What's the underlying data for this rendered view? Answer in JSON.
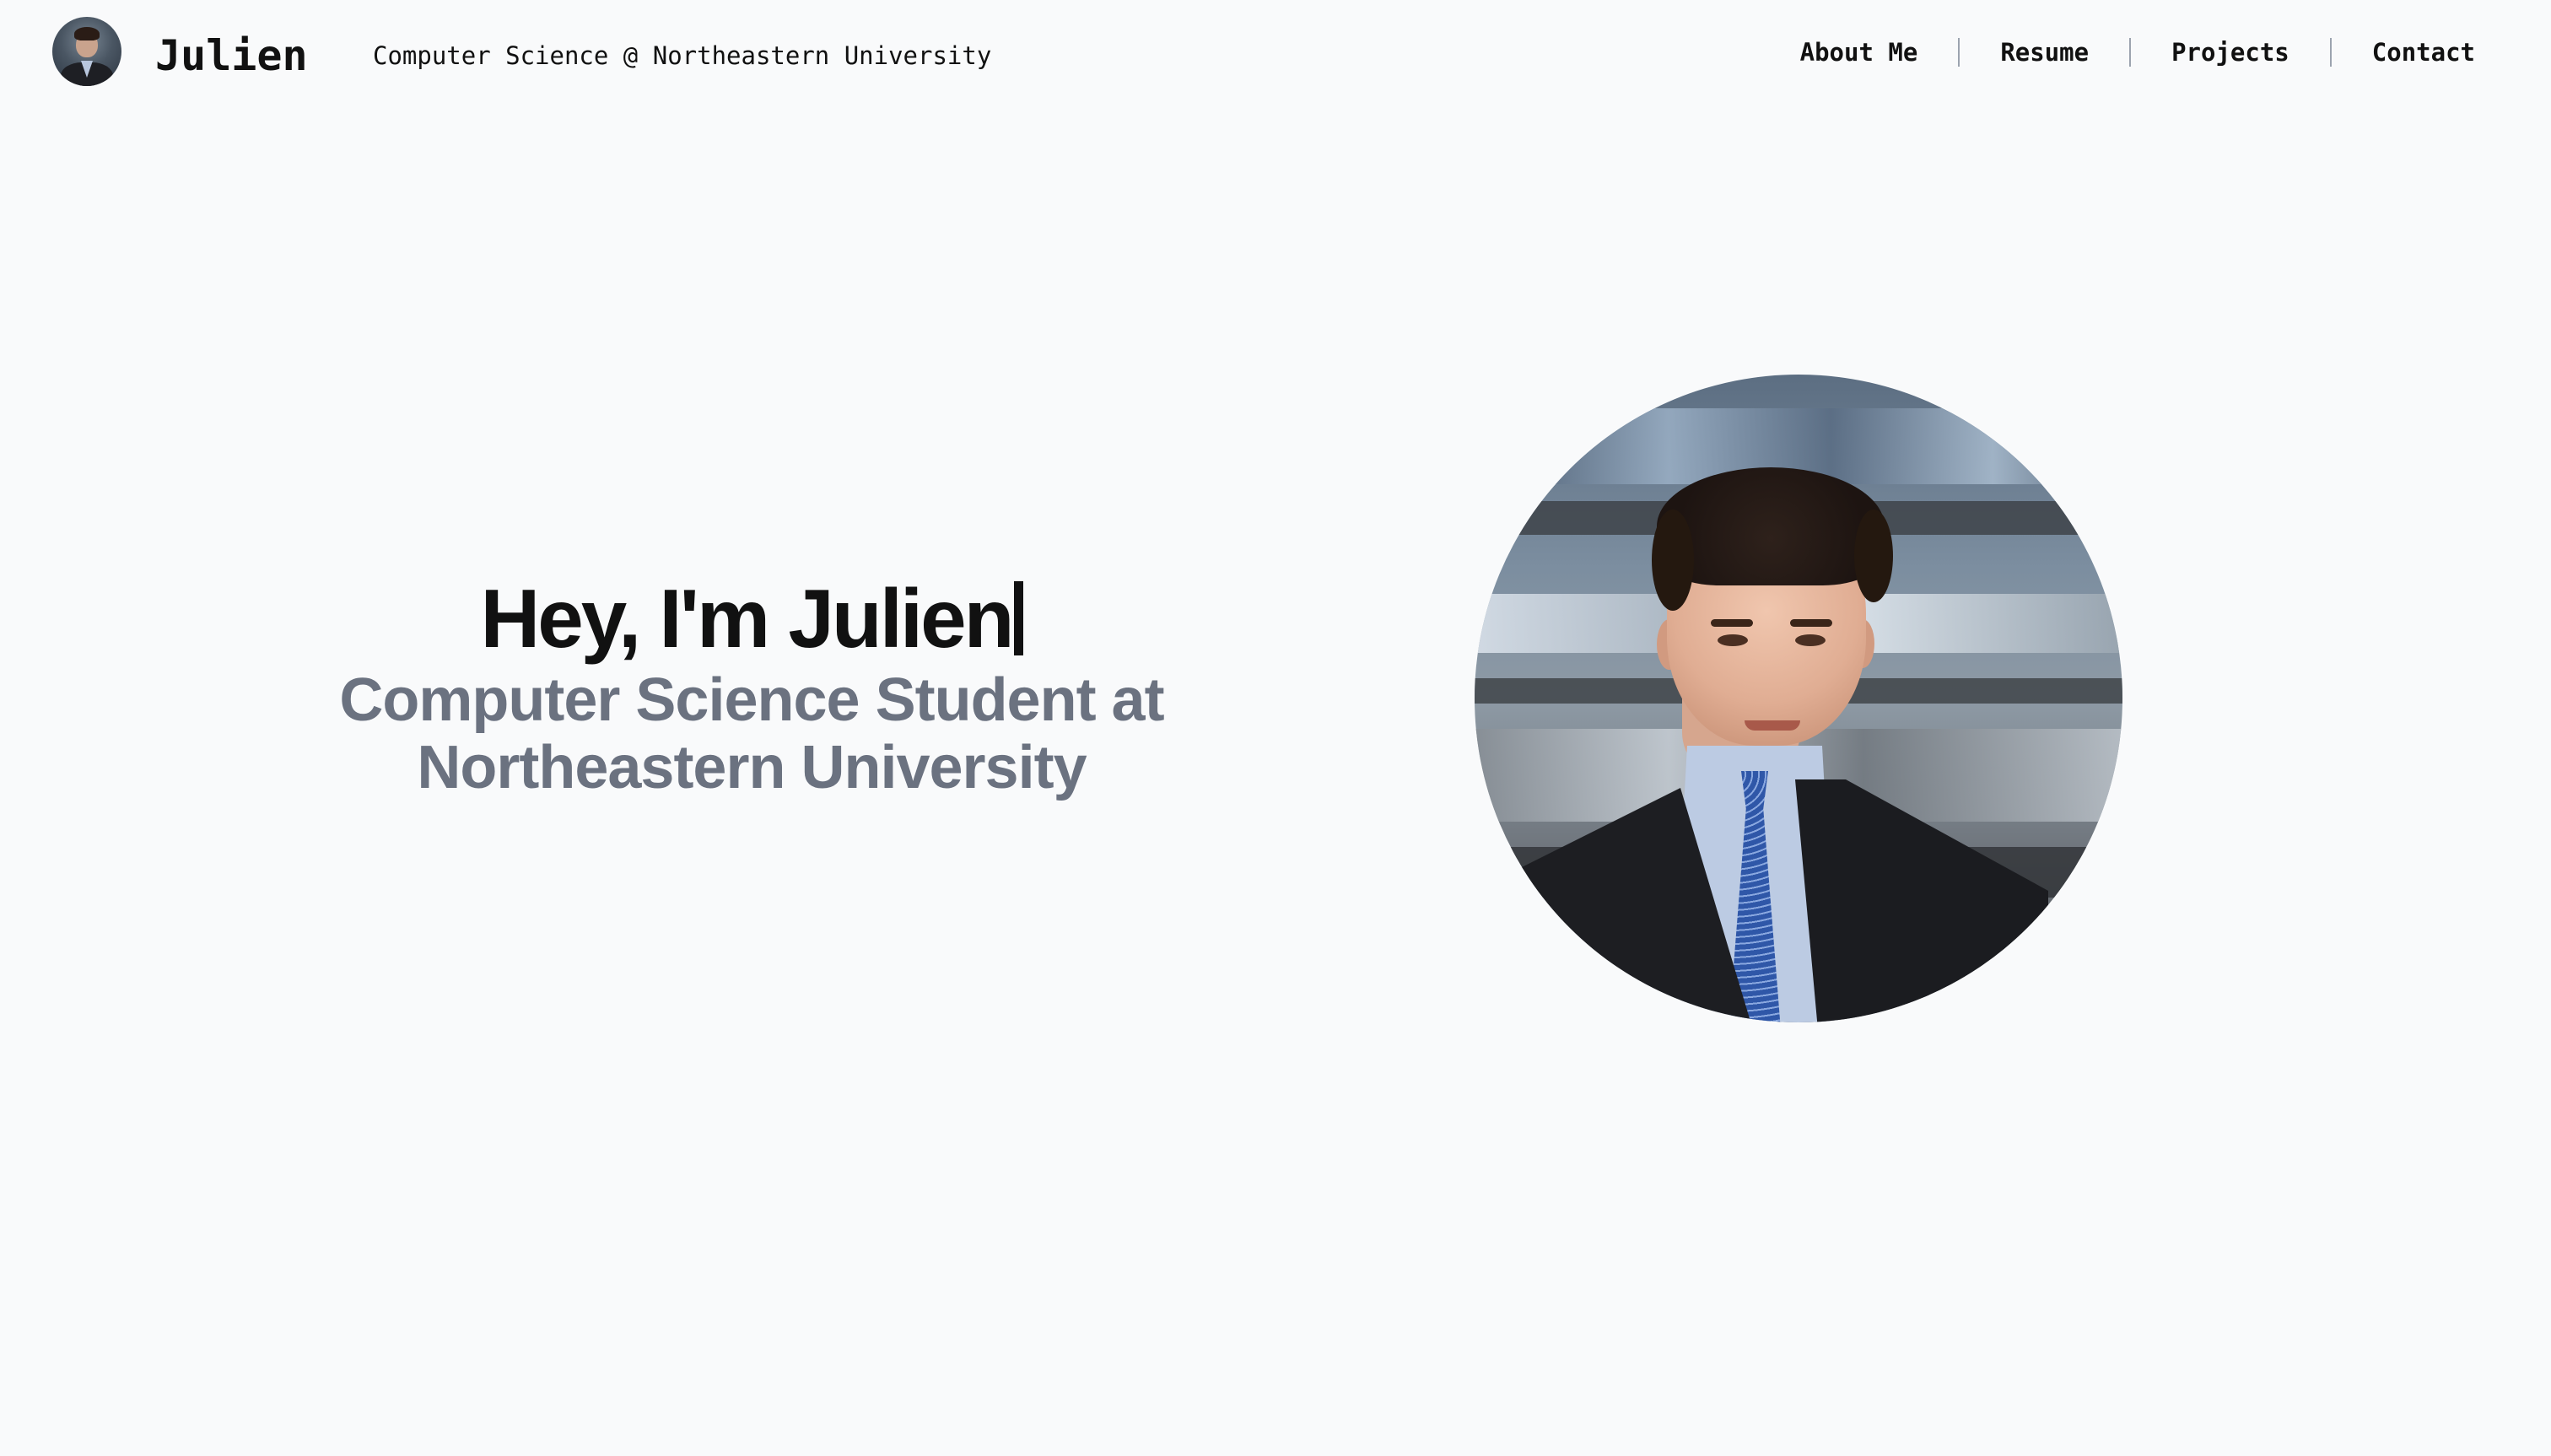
{
  "header": {
    "brand_name": "Julien",
    "tagline": "Computer Science @ Northeastern University",
    "nav": [
      {
        "label": "About Me"
      },
      {
        "label": "Resume"
      },
      {
        "label": "Projects"
      },
      {
        "label": "Contact"
      }
    ]
  },
  "hero": {
    "title": "Hey, I'm Julien",
    "subtitle_line1": "Computer Science Student at",
    "subtitle_line2": "Northeastern University"
  },
  "colors": {
    "background": "#f9fafb",
    "text_primary": "#111111",
    "text_secondary": "#6b7280",
    "separator": "#9ca3af"
  },
  "icons": {
    "avatar": "profile-photo",
    "portrait": "profile-photo-large"
  }
}
